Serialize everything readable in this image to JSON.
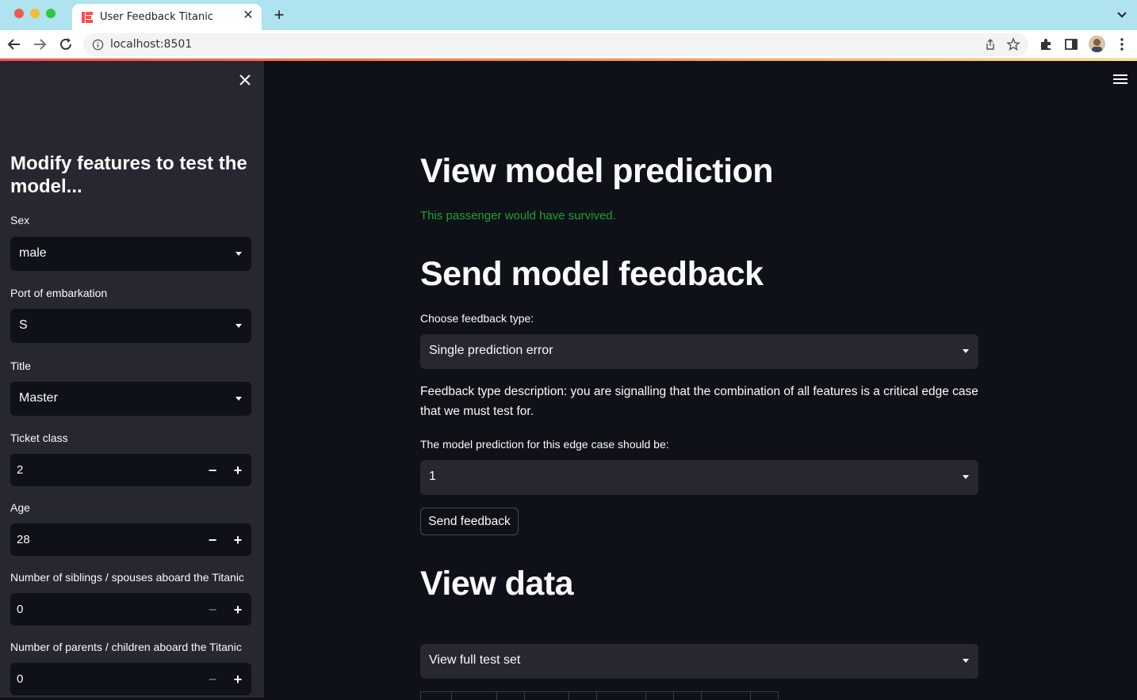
{
  "browser": {
    "tab_title": "User Feedback Titanic",
    "url": "localhost:8501"
  },
  "sidebar": {
    "heading": "Modify features to test the model...",
    "fields": [
      {
        "label": "Sex",
        "value": "male"
      },
      {
        "label": "Port of embarkation",
        "value": "S"
      },
      {
        "label": "Title",
        "value": "Master"
      },
      {
        "label": "Ticket class",
        "value": "2"
      },
      {
        "label": "Age",
        "value": "28"
      },
      {
        "label": "Number of siblings / spouses aboard the Titanic",
        "value": "0"
      },
      {
        "label": "Number of parents / children aboard the Titanic",
        "value": "0"
      }
    ],
    "stepper_minus": "−",
    "stepper_plus": "+"
  },
  "main": {
    "section_prediction_title": "View model prediction",
    "prediction_result": "This passenger would have survived.",
    "section_feedback_title": "Send model feedback",
    "feedback_type_label": "Choose feedback type:",
    "feedback_type_value": "Single prediction error",
    "feedback_description": "Feedback type description: you are signalling that the combination of all features is a critical edge case that we must test for.",
    "edge_case_label": "The model prediction for this edge case should be:",
    "edge_case_value": "1",
    "send_button_label": "Send feedback",
    "section_data_title": "View data",
    "data_view_value": "View full test set"
  },
  "colors": {
    "background": "#0e1117",
    "sidebar": "#262730",
    "success": "#21a131",
    "accent": "#ff4b4b"
  }
}
